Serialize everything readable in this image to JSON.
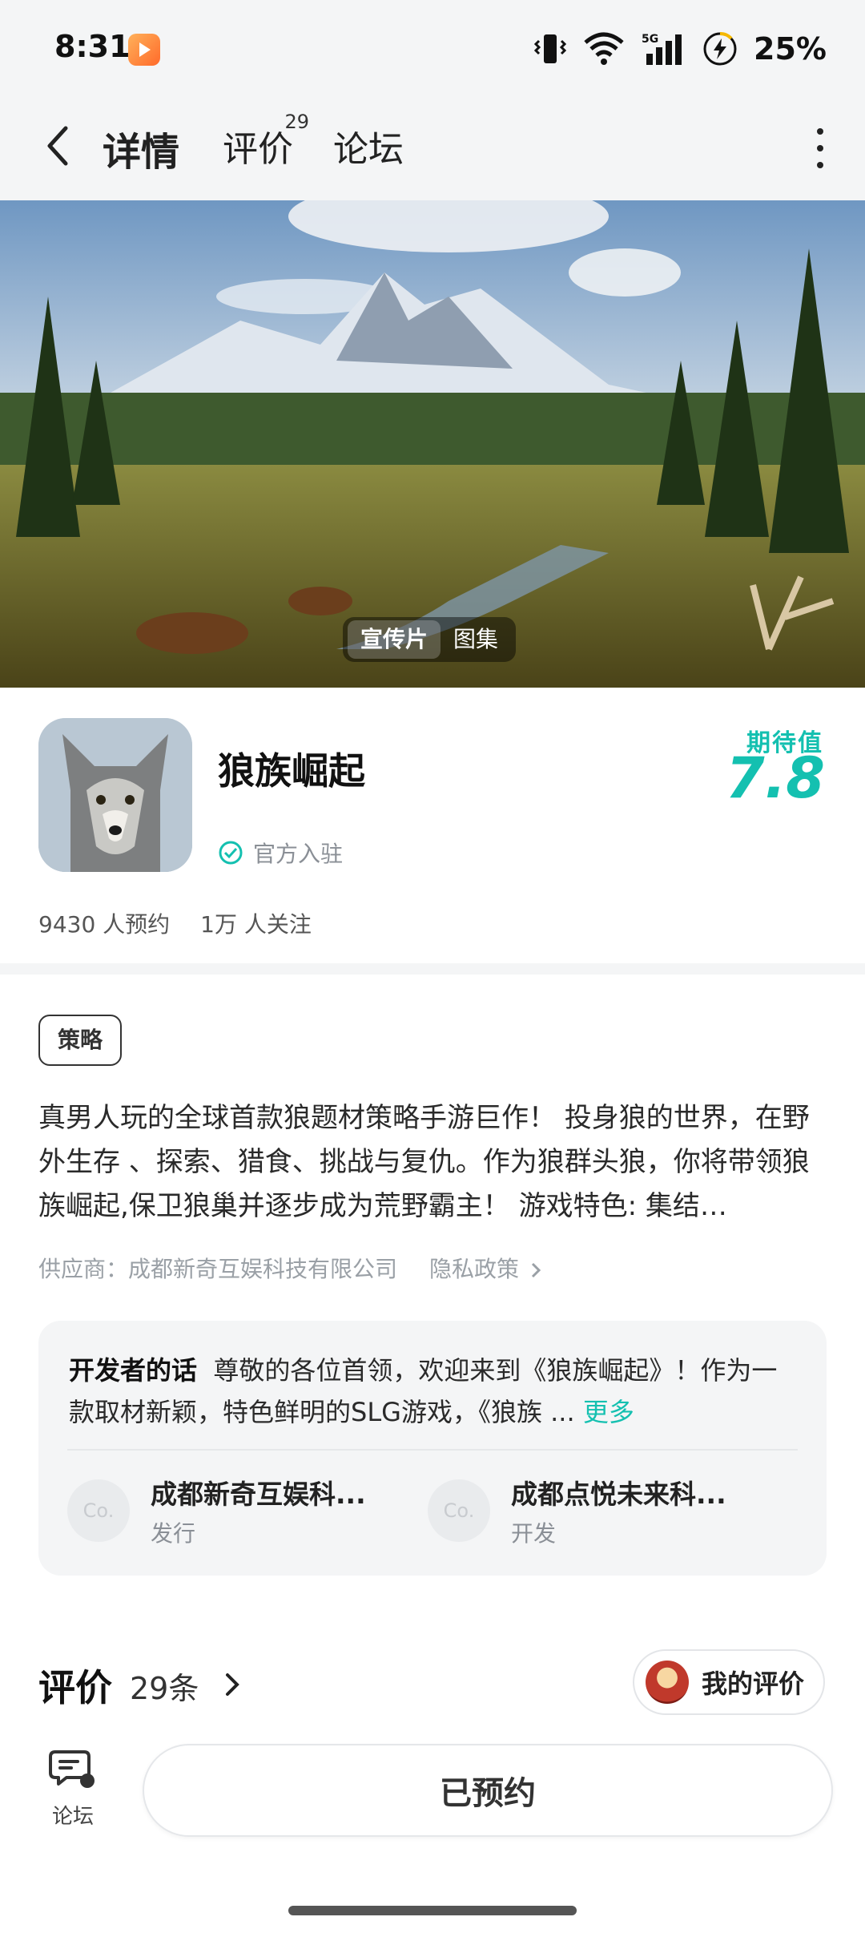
{
  "status_bar": {
    "time": "8:31",
    "network": "5G",
    "battery": "25%"
  },
  "nav": {
    "tabs": [
      {
        "label": "详情",
        "active": true
      },
      {
        "label": "评价",
        "badge": "29"
      },
      {
        "label": "论坛"
      }
    ]
  },
  "hero": {
    "tabs": [
      "宣传片",
      "图集"
    ],
    "active_tab": "宣传片"
  },
  "app": {
    "name": "狼族崛起",
    "official_label": "官方入驻",
    "expect_label": "期待值",
    "expect_value": "7.8",
    "reservations": "9430 人预约",
    "followers": "1万 人关注"
  },
  "detail": {
    "tag": "策略",
    "description": "真男人玩的全球首款狼题材策略手游巨作！ 投身狼的世界，在野外生存 、探索、猎食、挑战与复仇。作为狼群头狼，你将带领狼族崛起,保卫狼巢并逐步成为荒野霸主！ 游戏特色: 集结…",
    "supplier": "供应商：成都新奇互娱科技有限公司",
    "privacy": "隐私政策"
  },
  "developer": {
    "heading": "开发者的话",
    "text": "尊敬的各位首领，欢迎来到《狼族崛起》！作为一款取材新颖，特色鲜明的SLG游戏，《狼族 ...",
    "more": "更多",
    "companies": [
      {
        "logo": "Co.",
        "name": "成都新奇互娱科...",
        "role": "发行"
      },
      {
        "logo": "Co.",
        "name": "成都点悦未来科...",
        "role": "开发"
      }
    ]
  },
  "reviews": {
    "title": "评价",
    "count": "29条",
    "my_review": "我的评价"
  },
  "bottom": {
    "forum": "论坛",
    "reserve_button": "已预约"
  },
  "colors": {
    "accent": "#13d3c0",
    "background": "#ffffff",
    "panel": "#f4f5f6"
  }
}
